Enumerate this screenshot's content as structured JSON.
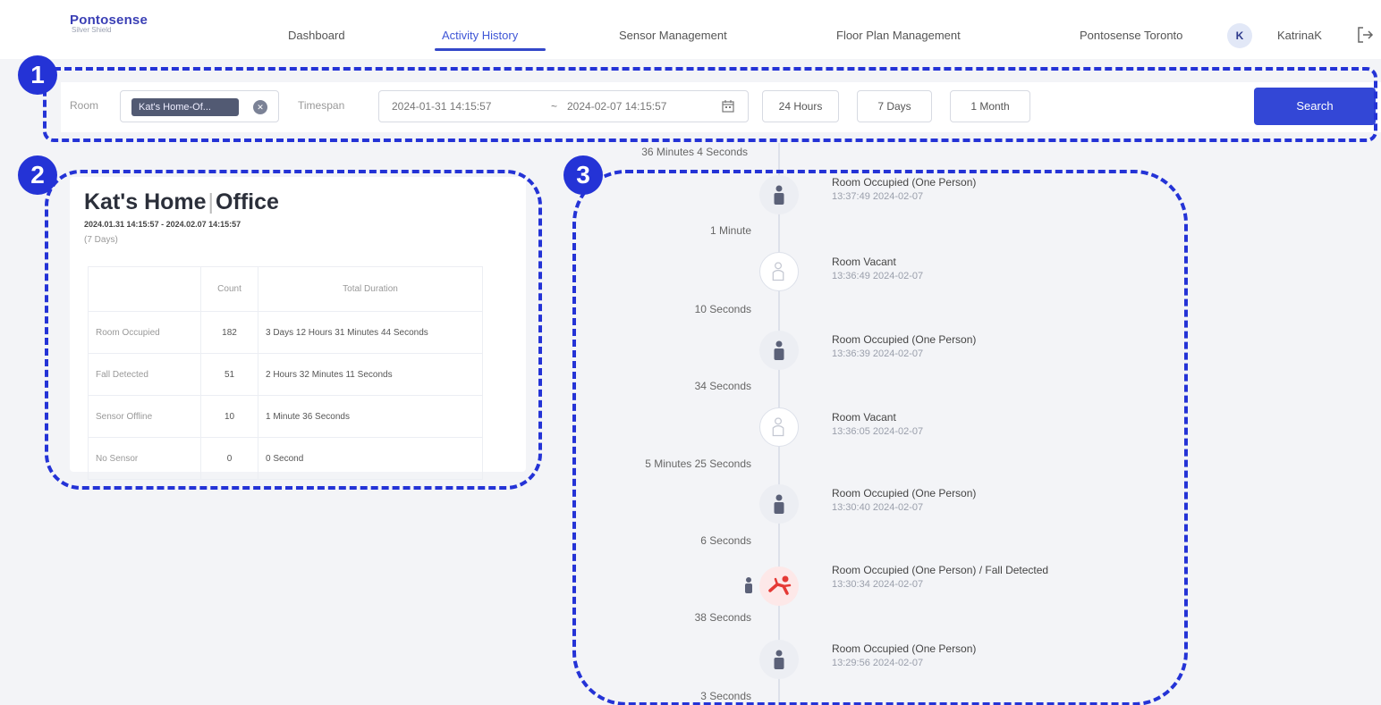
{
  "header": {
    "logo": {
      "title": "Pontosense",
      "subtitle": "Silver Shield"
    },
    "nav": [
      {
        "label": "Dashboard",
        "active": false
      },
      {
        "label": "Activity History",
        "active": true
      },
      {
        "label": "Sensor Management",
        "active": false
      },
      {
        "label": "Floor Plan Management",
        "active": false
      }
    ],
    "site_name": "Pontosense Toronto",
    "avatar_initial": "K",
    "user_name": "KatrinaK"
  },
  "filter": {
    "room_label": "Room",
    "room_value": "Kat's Home-Of...",
    "timespan_label": "Timespan",
    "start": "2024-01-31 14:15:57",
    "separator": "~",
    "end": "2024-02-07 14:15:57",
    "quick_buttons": [
      "24 Hours",
      "7 Days",
      "1 Month"
    ],
    "search_label": "Search"
  },
  "summary": {
    "home": "Kat's Home",
    "room": "Office",
    "range": "2024.01.31 14:15:57 - 2024.02.07 14:15:57",
    "days": "(7 Days)",
    "headers": [
      "",
      "Count",
      "Total Duration"
    ],
    "rows": [
      {
        "category": "Room Occupied",
        "count": "182",
        "duration": "3 Days 12 Hours 31 Minutes 44 Seconds"
      },
      {
        "category": "Fall Detected",
        "count": "51",
        "duration": "2 Hours 32 Minutes 11 Seconds"
      },
      {
        "category": "Sensor Offline",
        "count": "10",
        "duration": "1 Minute 36 Seconds"
      },
      {
        "category": "No Sensor",
        "count": "0",
        "duration": "0 Second"
      }
    ]
  },
  "timeline": {
    "top_gap": "36 Minutes 4 Seconds",
    "events": [
      {
        "type": "occupied",
        "title": "Room Occupied (One Person)",
        "time": "13:37:49 2024-02-07",
        "gap_after": "1 Minute"
      },
      {
        "type": "vacant",
        "title": "Room Vacant",
        "time": "13:36:49 2024-02-07",
        "gap_after": "10 Seconds"
      },
      {
        "type": "occupied",
        "title": "Room Occupied (One Person)",
        "time": "13:36:39 2024-02-07",
        "gap_after": "34 Seconds"
      },
      {
        "type": "vacant",
        "title": "Room Vacant",
        "time": "13:36:05 2024-02-07",
        "gap_after": "5 Minutes 25 Seconds"
      },
      {
        "type": "occupied",
        "title": "Room Occupied (One Person)",
        "time": "13:30:40 2024-02-07",
        "gap_after": "6 Seconds"
      },
      {
        "type": "fall",
        "title": "Room Occupied  (One Person) / Fall Detected",
        "time": "13:30:34 2024-02-07",
        "gap_after": "38 Seconds"
      },
      {
        "type": "occupied",
        "title": "Room Occupied (One Person)",
        "time": "13:29:56 2024-02-07",
        "gap_after": "3 Seconds"
      }
    ]
  },
  "annotations": [
    "1",
    "2",
    "3"
  ],
  "colors": {
    "accent": "#3347d6",
    "annotation": "#2433d6",
    "fall": "#e53935",
    "person": "#5b6178"
  }
}
